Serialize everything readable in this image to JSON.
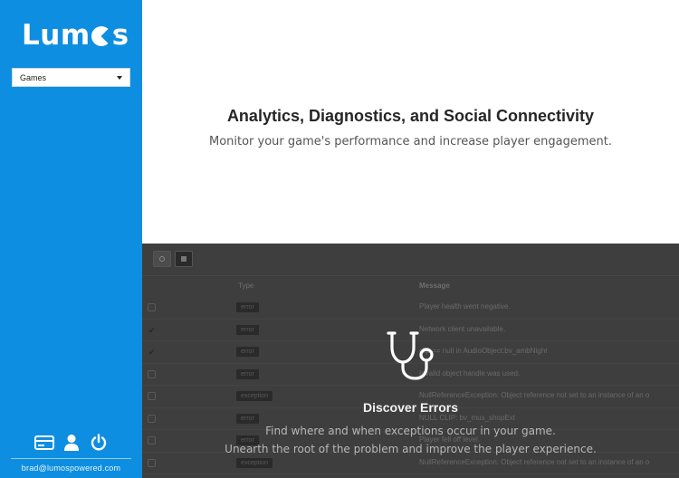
{
  "sidebar": {
    "logo": {
      "before": "Lum",
      "after": "s"
    },
    "game_select": {
      "value": "Games"
    },
    "icons": [
      "credit-card-icon",
      "user-icon",
      "power-icon"
    ],
    "email": "brad@lumospowered.com"
  },
  "hero": {
    "title": "Analytics, Diagnostics, and Social Connectivity",
    "subtitle": "Monitor your game's performance and increase player engagement."
  },
  "preview": {
    "columns": {
      "type": "Type",
      "message": "Message"
    },
    "rows": [
      {
        "checked": false,
        "type": "error",
        "message": "Player health went negative."
      },
      {
        "checked": true,
        "type": "error",
        "message": "Network client unavailable."
      },
      {
        "checked": true,
        "type": "error",
        "message": "clip == null in AudioObject:bv_ambNight"
      },
      {
        "checked": false,
        "type": "error",
        "message": "Invalid object handle was used."
      },
      {
        "checked": false,
        "type": "exception",
        "message": "NullReferenceException: Object reference not set to an instance of an o"
      },
      {
        "checked": false,
        "type": "error",
        "message": "NULL CLIP: bv_mus_shopExt"
      },
      {
        "checked": false,
        "type": "error",
        "message": "Player fell off level."
      },
      {
        "checked": false,
        "type": "exception",
        "message": "NullReferenceException: Object reference not set to an instance of an o"
      }
    ]
  },
  "feature": {
    "icon": "stethoscope-icon",
    "title": "Discover Errors",
    "line1": "Find where and when exceptions occur in your game.",
    "line2": "Unearth the root of the problem and improve the player experience."
  },
  "colors": {
    "sidebar": "#0e8ee0",
    "panel": "#3e3e3e"
  }
}
